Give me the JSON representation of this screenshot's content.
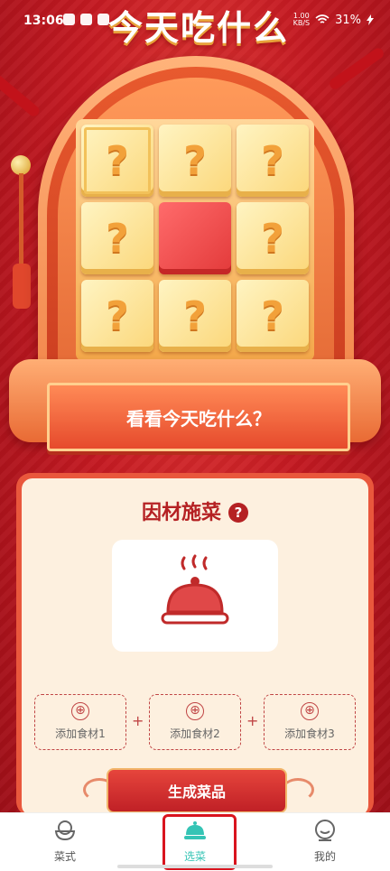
{
  "status_bar": {
    "time": "13:06",
    "speed_value": "1.00",
    "speed_unit": "KB/S",
    "battery": "31%"
  },
  "title": "今天吃什么",
  "slot_machine": {
    "cells": [
      "?",
      "?",
      "?",
      "?",
      "",
      "?",
      "?",
      "?",
      "?"
    ],
    "spin_button": "看看今天吃什么？"
  },
  "panel": {
    "title": "因材施菜",
    "help": "?",
    "ingredients": [
      "添加食材1",
      "添加食材2",
      "添加食材3"
    ],
    "plus_sign": "⊕",
    "join_sign": "+",
    "generate_button": "生成菜品"
  },
  "bottom_nav": {
    "items": [
      {
        "label": "菜式",
        "icon": "bowl-icon"
      },
      {
        "label": "选菜",
        "icon": "cloche-icon"
      },
      {
        "label": "我的",
        "icon": "profile-icon"
      }
    ],
    "active_index": 1
  },
  "colors": {
    "accent": "#35c4b5",
    "primary_red": "#c41a22",
    "panel_bg": "#fdf0df"
  }
}
